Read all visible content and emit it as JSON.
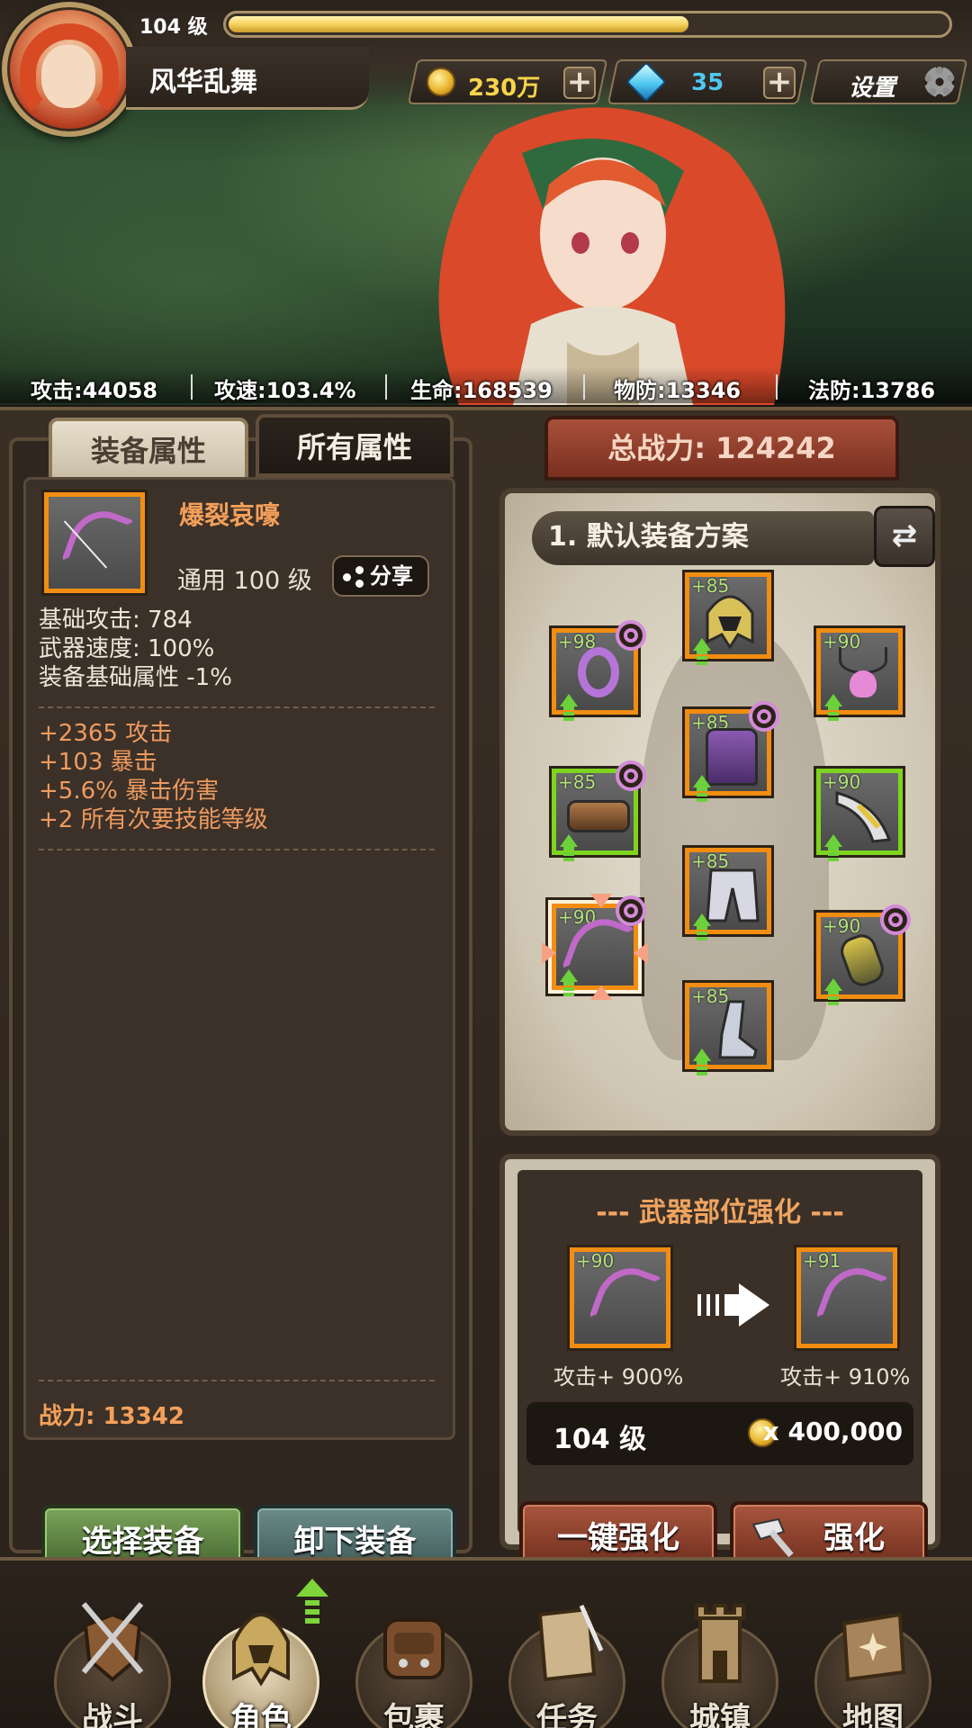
{
  "header": {
    "level_text": "104 级",
    "xp_fraction": 0.64,
    "player_name": "风华乱舞",
    "gold": "230万",
    "gems": "35",
    "settings_label": "设置"
  },
  "stats": [
    {
      "label": "攻击:44058"
    },
    {
      "label": "攻速:103.4%"
    },
    {
      "label": "生命:168539"
    },
    {
      "label": "物防:13346"
    },
    {
      "label": "法防:13786"
    }
  ],
  "left_panel": {
    "tabs": [
      {
        "label": "装备属性",
        "active": true
      },
      {
        "label": "所有属性",
        "active": false
      }
    ],
    "item": {
      "name": "爆裂哀嚎",
      "meta": "通用  100 级",
      "share_label": "分享",
      "base_stats": [
        "基础攻击:  784",
        "武器速度:  100%",
        "装备基础属性 -1%"
      ],
      "bonus_stats": [
        "+2365 攻击",
        "+103 暴击",
        "+5.6% 暴击伤害",
        "+2 所有次要技能等级"
      ],
      "power": "战力:  13342"
    },
    "buttons": {
      "select": "选择装备",
      "unequip": "卸下装备"
    }
  },
  "right_panel": {
    "total_power": "总战力:  124242",
    "scheme_label": "1. 默认装备方案",
    "slots": [
      {
        "name": "helmet-slot",
        "level": "+85"
      },
      {
        "name": "ring-slot",
        "level": "+98"
      },
      {
        "name": "necklace-slot",
        "level": "+90"
      },
      {
        "name": "armor-slot",
        "level": "+85"
      },
      {
        "name": "belt-slot",
        "level": "+85"
      },
      {
        "name": "offhand-slot",
        "level": "+90"
      },
      {
        "name": "pants-slot",
        "level": "+85"
      },
      {
        "name": "weapon-slot",
        "level": "+90"
      },
      {
        "name": "amulet-slot",
        "level": "+90"
      },
      {
        "name": "boots-slot",
        "level": "+85"
      }
    ],
    "enhance": {
      "title": "--- 武器部位强化 ---",
      "from_level": "+90",
      "to_level": "+91",
      "from_label": "攻击+ 900%",
      "to_label": "攻击+ 910%",
      "cost_level": "104 级",
      "cost_amount": "x 400,000",
      "one_click_label": "一键强化",
      "enhance_label": "强化"
    }
  },
  "nav": [
    {
      "label": "战斗",
      "icon": "battle-icon"
    },
    {
      "label": "角色",
      "icon": "character-icon",
      "active": true
    },
    {
      "label": "包裹",
      "icon": "bag-icon"
    },
    {
      "label": "任务",
      "icon": "quest-icon"
    },
    {
      "label": "城镇",
      "icon": "town-icon"
    },
    {
      "label": "地图",
      "icon": "map-icon"
    }
  ],
  "colors": {
    "accent_orange": "#f4a05a",
    "slot_orange": "#f28d12",
    "slot_green": "#7ed41e",
    "gem_blue": "#4fc8f0"
  }
}
